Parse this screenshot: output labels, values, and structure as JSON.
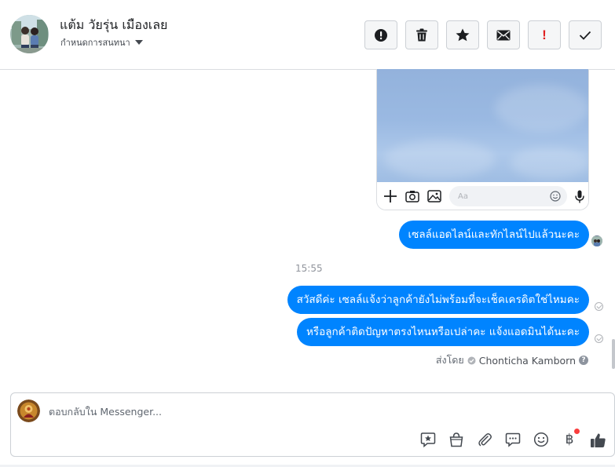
{
  "header": {
    "contact_name": "แต้ม วัยรุ่น เมืองเลย",
    "assign_label": "กำหนดการสนทนา",
    "actions": [
      {
        "name": "spam",
        "icon": "alert-circle-icon"
      },
      {
        "name": "delete",
        "icon": "trash-icon"
      },
      {
        "name": "star",
        "icon": "star-icon"
      },
      {
        "name": "unread",
        "icon": "envelope-icon"
      },
      {
        "name": "follow-up",
        "icon": "exclamation-icon",
        "text": "!"
      },
      {
        "name": "done",
        "icon": "checkmark-icon"
      }
    ]
  },
  "thread": {
    "preview": {
      "input_placeholder": "Aa",
      "icons": [
        "plus-icon",
        "camera-icon",
        "gallery-icon",
        "emoji-icon",
        "microphone-icon"
      ]
    },
    "messages": [
      {
        "text": "เซลล์แอดไลน์และทักไลน์ไปแล้วนะคะ",
        "status": "seen"
      },
      {
        "text": "สวัสดีค่ะ เซลล์แจ้งว่าลูกค้ายังไม่พร้อมที่จะเช็คเครดิตใช่ไหมคะ",
        "status": "sent"
      },
      {
        "text": "หรือลูกค้าติดปัญหาตรงไหนหรือเปล่าคะ แจ้งแอดมินได้นะคะ",
        "status": "sent"
      }
    ],
    "timestamp": "15:55",
    "sent_by_label": "ส่งโดย",
    "sent_by_agent": "Chonticha Kamborn",
    "help_mark": "?"
  },
  "composer": {
    "placeholder": "ตอบกลับใน Messenger...",
    "tools": [
      "saved-reply-icon",
      "shopping-bag-icon",
      "attachment-icon",
      "chat-bubble-icon",
      "emoji-icon",
      "baht-payment-icon",
      "thumbs-up-icon"
    ],
    "baht_symbol": "฿"
  },
  "colors": {
    "bubble": "#0084ff",
    "border": "#ccd0d5",
    "accent_red": "#e02020"
  }
}
